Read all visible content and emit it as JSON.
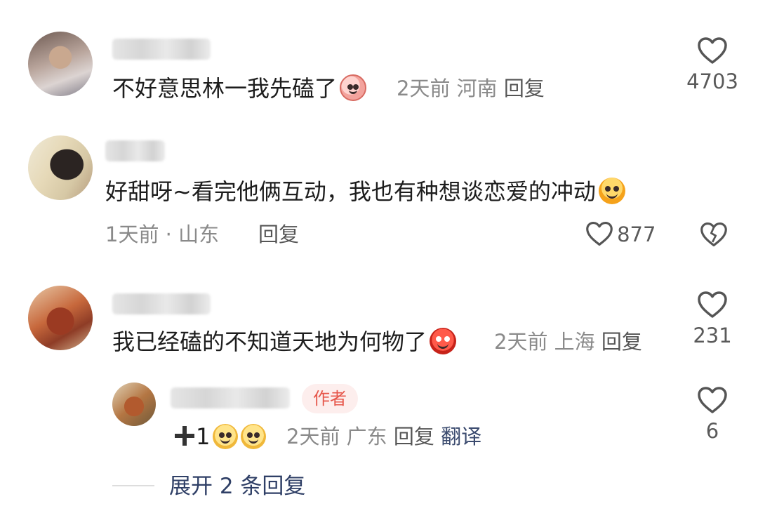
{
  "comments": [
    {
      "text": "不好意思林一我先磕了",
      "emoji": "peach-shy-emoji",
      "time": "2天前",
      "location": "河南",
      "reply": "回复",
      "likes": "4703"
    },
    {
      "text": "好甜呀~看完他俩互动，我也有种想谈恋爱的冲动",
      "emoji": "laughing-emoji",
      "time_location": "1天前 · 山东",
      "reply": "回复",
      "likes": "877"
    },
    {
      "text": "我已经磕的不知道天地为何物了",
      "emoji": "angry-devil-emoji",
      "time": "2天前",
      "location": "上海",
      "reply": "回复",
      "likes": "231"
    }
  ],
  "reply": {
    "badge": "作者",
    "text": "1",
    "emojis": [
      "sunglasses-emoji",
      "sunglasses-emoji"
    ],
    "time": "2天前",
    "location": "广东",
    "reply": "回复",
    "translate": "翻译",
    "likes": "6"
  },
  "expand_label": "展开 2 条回复",
  "colors": {
    "badge_text": "#e6564a",
    "badge_bg": "#fdeeed",
    "link": "#2f3f66",
    "meta": "#8a8a8a"
  }
}
